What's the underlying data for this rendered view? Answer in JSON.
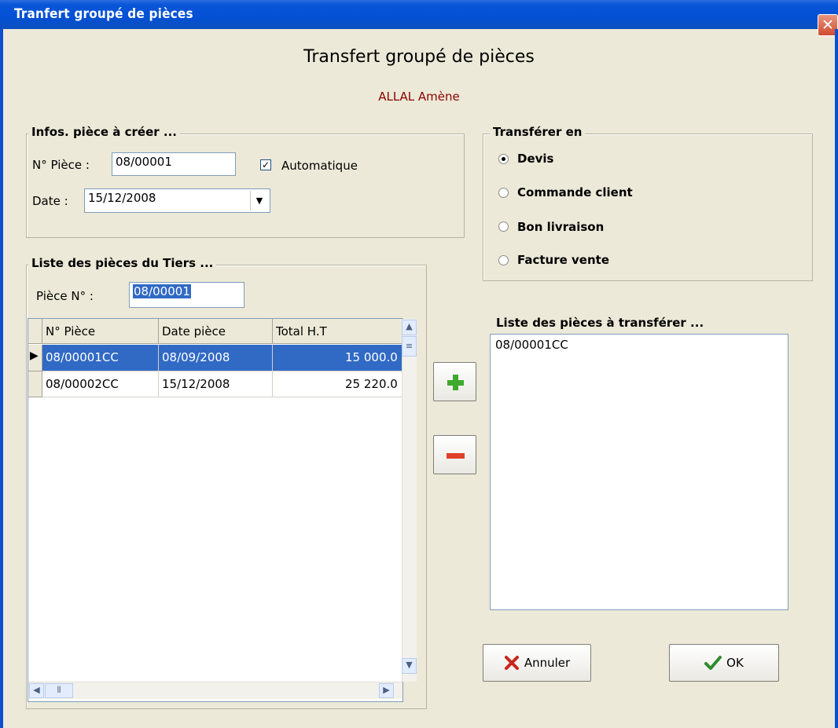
{
  "window": {
    "title": "Tranfert groupé de pièces",
    "close_glyph": "✕"
  },
  "header": {
    "title": "Transfert groupé de pièces",
    "subtitle": "ALLAL Amène",
    "subtitle_color": "#8B0000"
  },
  "infos": {
    "group_label": "Infos. pièce à créer  ...",
    "num_label": "N° Pièce :",
    "num_value": "08/00001",
    "auto_label": "Automatique",
    "auto_checked": true,
    "date_label": "Date :",
    "date_value": "15/12/2008"
  },
  "transfer": {
    "group_label": "Transférer en",
    "options": [
      {
        "label": "Devis",
        "selected": true
      },
      {
        "label": "Commande client",
        "selected": false
      },
      {
        "label": "Bon livraison",
        "selected": false
      },
      {
        "label": "Facture vente",
        "selected": false
      }
    ]
  },
  "tiers": {
    "group_label": "Liste des pièces du Tiers ...",
    "piece_label": "Pièce N° :",
    "piece_value": "08/00001",
    "columns": [
      "N° Pièce",
      "Date pièce",
      "Total H.T"
    ],
    "rows": [
      {
        "num": "08/00001CC",
        "date": "08/09/2008",
        "total": "15 000.0",
        "selected": true
      },
      {
        "num": "08/00002CC",
        "date": "15/12/2008",
        "total": "25 220.0",
        "selected": false
      }
    ]
  },
  "target": {
    "group_label": "Liste des pièces à transférer ...",
    "items": [
      "08/00001CC"
    ]
  },
  "actions": {
    "add_icon": "plus-icon",
    "remove_icon": "minus-icon",
    "cancel_label": "Annuler",
    "ok_label": "OK"
  },
  "colors": {
    "titlebar": "#0A56D9",
    "selection": "#316AC5",
    "add": "#3DAA2E",
    "remove": "#E0402A"
  }
}
